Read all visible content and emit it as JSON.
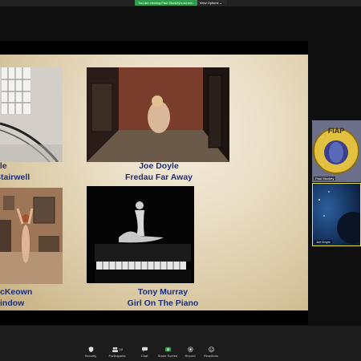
{
  "banner": {
    "viewing_text": "You are viewing Paul Stuckey's screen",
    "view_options_label": "View Options ⌄"
  },
  "slide": {
    "captions": [
      {
        "line1": "yle",
        "line2": "Stairwell"
      },
      {
        "line1": "Joe Doyle",
        "line2": "Fredau Far Away"
      },
      {
        "line1": "cKeown",
        "line2": "indow"
      },
      {
        "line1": "Tony Murray",
        "line2": "Girl On The Piano"
      }
    ]
  },
  "participants": [
    {
      "name": "Paul Stuckey",
      "logo_text": "FIAP"
    },
    {
      "name": "Joe Doyle"
    }
  ],
  "toolbar": {
    "items": [
      {
        "label": "Security",
        "icon": "shield-icon"
      },
      {
        "label": "Participants",
        "icon": "people-icon",
        "count": "10"
      },
      {
        "label": "Chat",
        "icon": "chat-icon"
      },
      {
        "label": "Share Screen",
        "icon": "share-screen-icon",
        "color": "#2e9e4a"
      },
      {
        "label": "Record",
        "icon": "record-icon"
      },
      {
        "label": "Reactions",
        "icon": "smiley-icon"
      }
    ]
  },
  "colors": {
    "caption": "#1c2f7a",
    "share_green": "#2e9e4a",
    "active_speaker_border": "#e8e23a"
  }
}
